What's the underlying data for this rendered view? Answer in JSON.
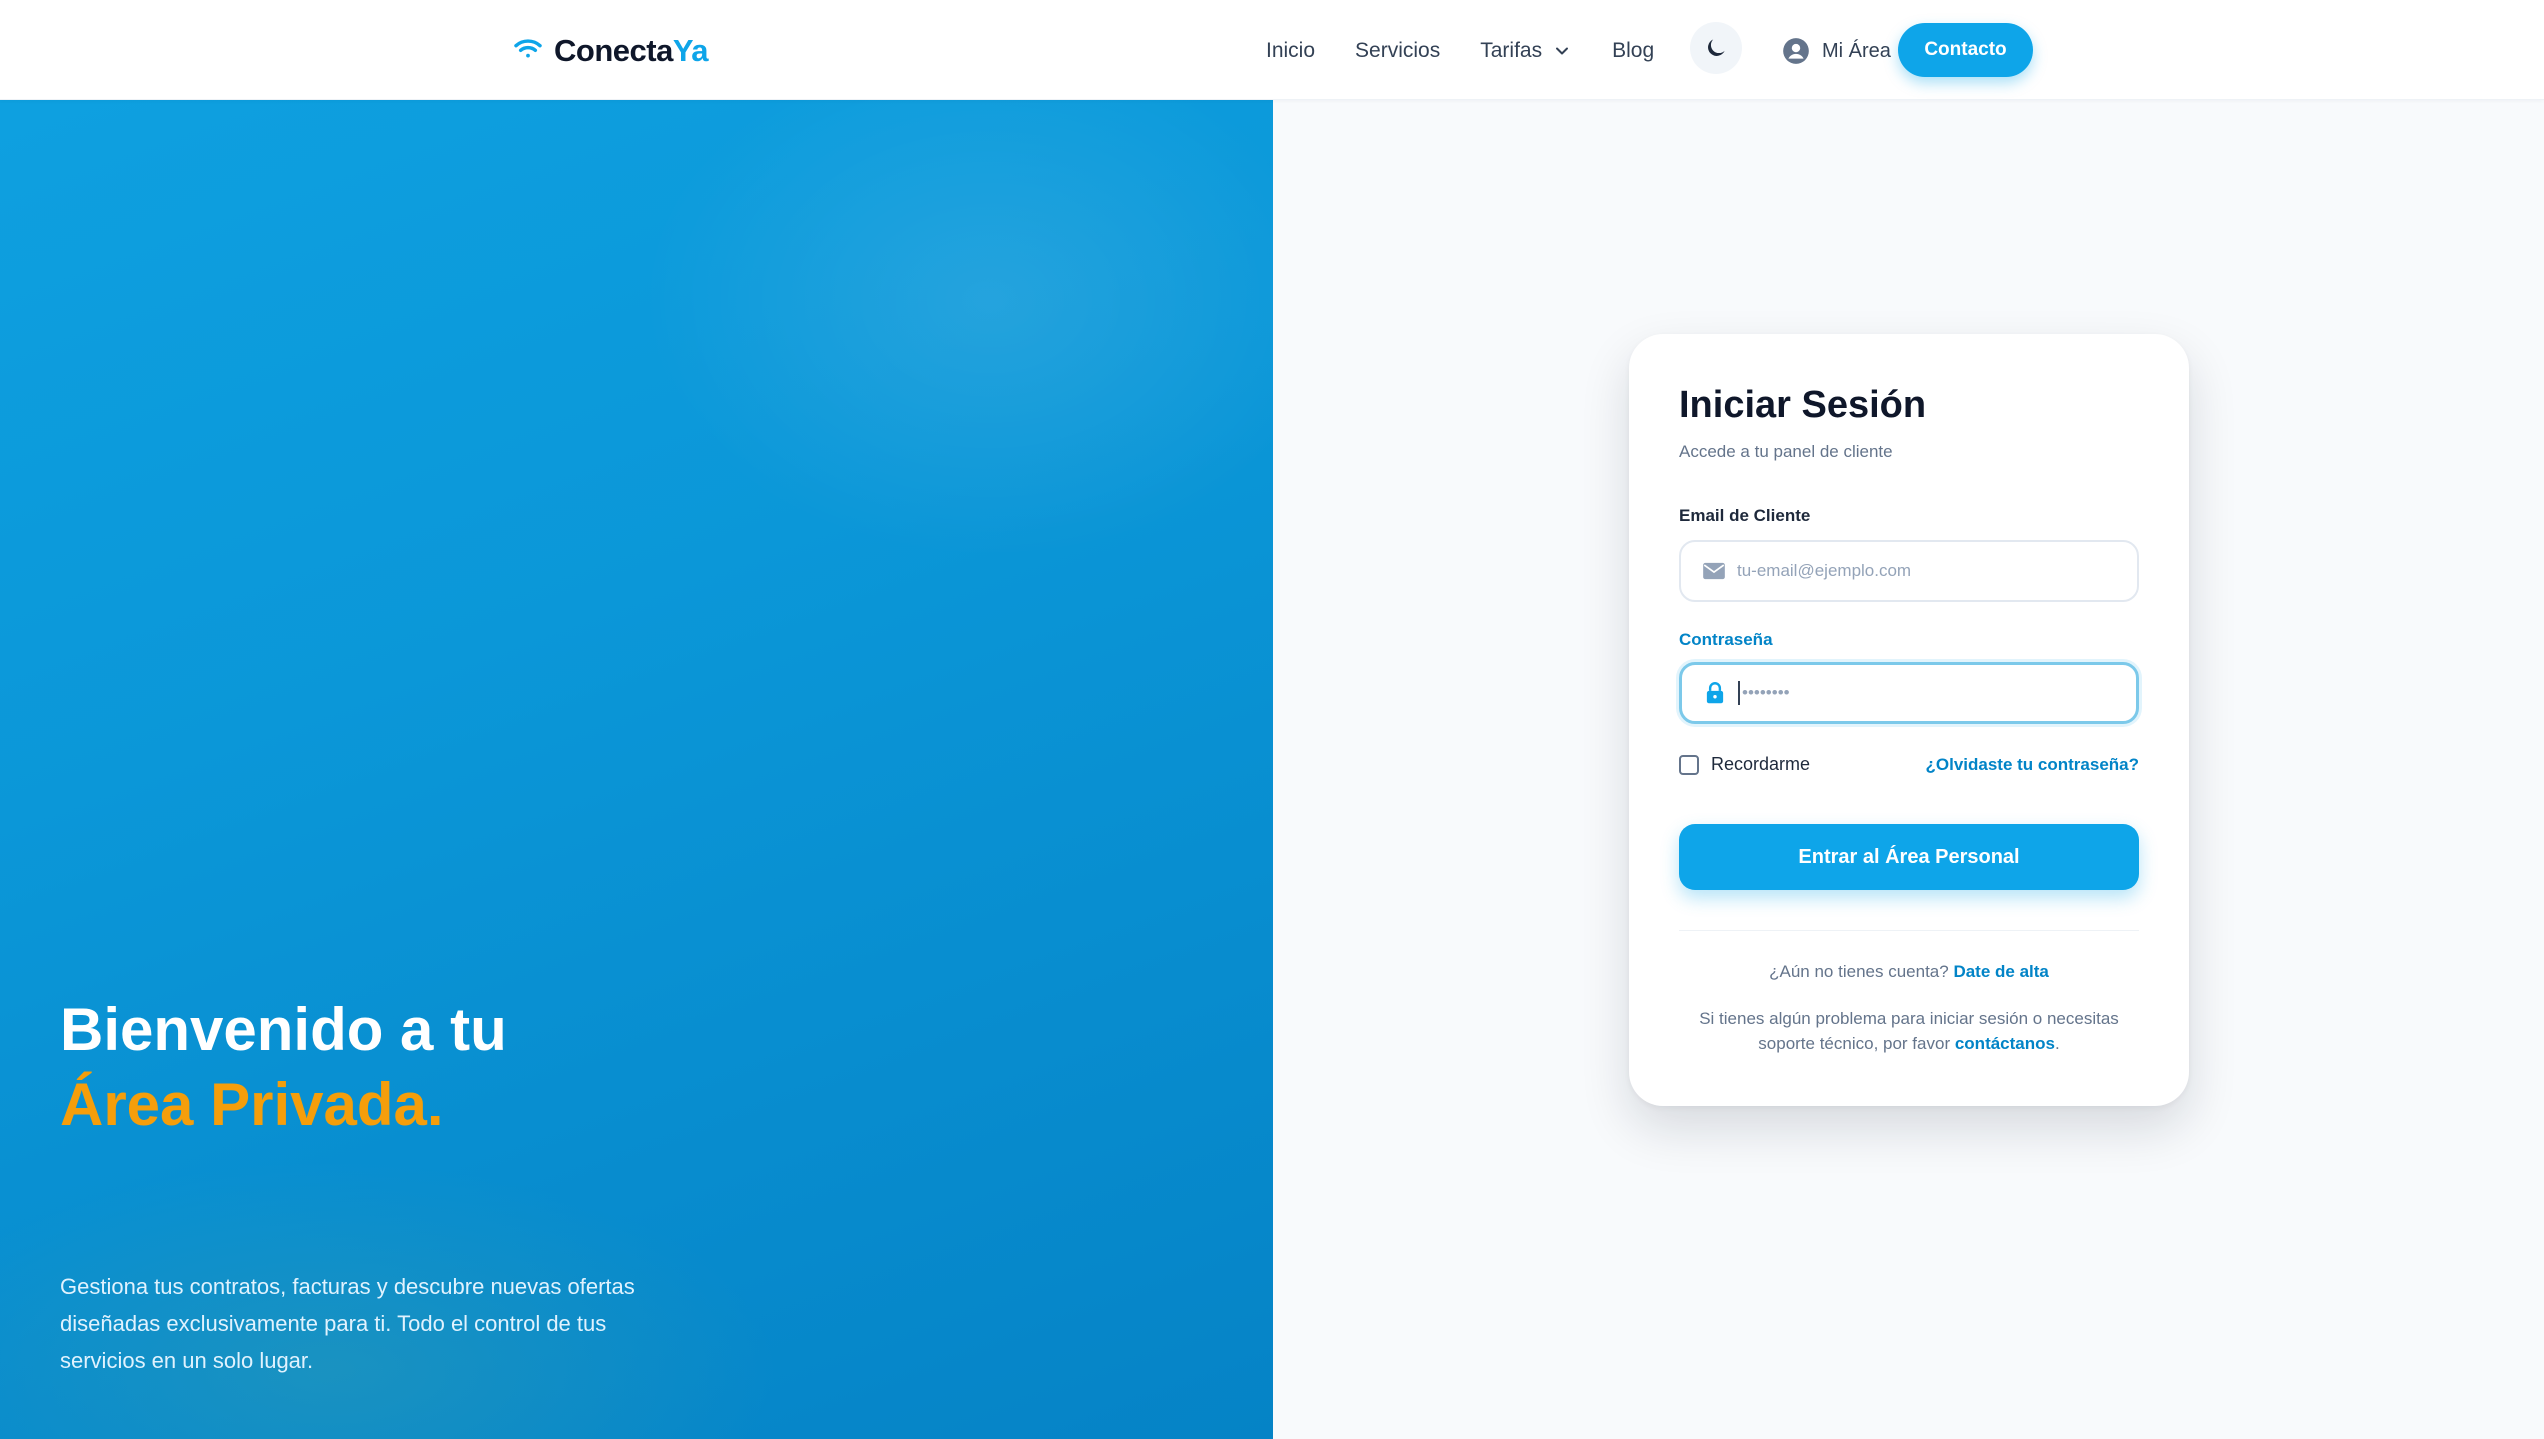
{
  "brand": {
    "name_main": "Conecta",
    "name_accent": "Ya",
    "icon": "wifi-icon"
  },
  "nav": {
    "links": [
      {
        "label": "Inicio"
      },
      {
        "label": "Servicios"
      },
      {
        "label": "Tarifas",
        "has_dropdown": true
      },
      {
        "label": "Blog"
      }
    ],
    "theme_toggle_icon": "moon-icon",
    "account_label": "Mi Área",
    "account_icon": "user-circle-icon",
    "contact_label": "Contacto"
  },
  "hero": {
    "title_line1": "Bienvenido a tu",
    "title_line2": "Área Privada.",
    "description": "Gestiona tus contratos, facturas y descubre nuevas ofertas diseñadas exclusivamente para ti. Todo el control de tus servicios en un solo lugar."
  },
  "login": {
    "title": "Iniciar Sesión",
    "subtitle": "Accede a tu panel de cliente",
    "email": {
      "label": "Email de Cliente",
      "placeholder": "tu-email@ejemplo.com",
      "icon": "envelope-icon"
    },
    "password": {
      "label": "Contraseña",
      "placeholder": "••••••••",
      "icon": "lock-icon"
    },
    "remember_label": "Recordarme",
    "forgot_label": "¿Olvidaste tu contraseña?",
    "submit_label": "Entrar al Área Personal",
    "signup_prompt": "¿Aún no tienes cuenta?",
    "signup_link": "Date de alta",
    "help_text": "Si tienes algún problema para iniciar sesión o necesitas soporte técnico, por favor",
    "help_link": "contáctanos",
    "help_end": "."
  },
  "colors": {
    "primary": "#0ea5e9",
    "link": "#0284c7",
    "accent_orange": "#f59e0b",
    "dark": "#0f172a"
  }
}
